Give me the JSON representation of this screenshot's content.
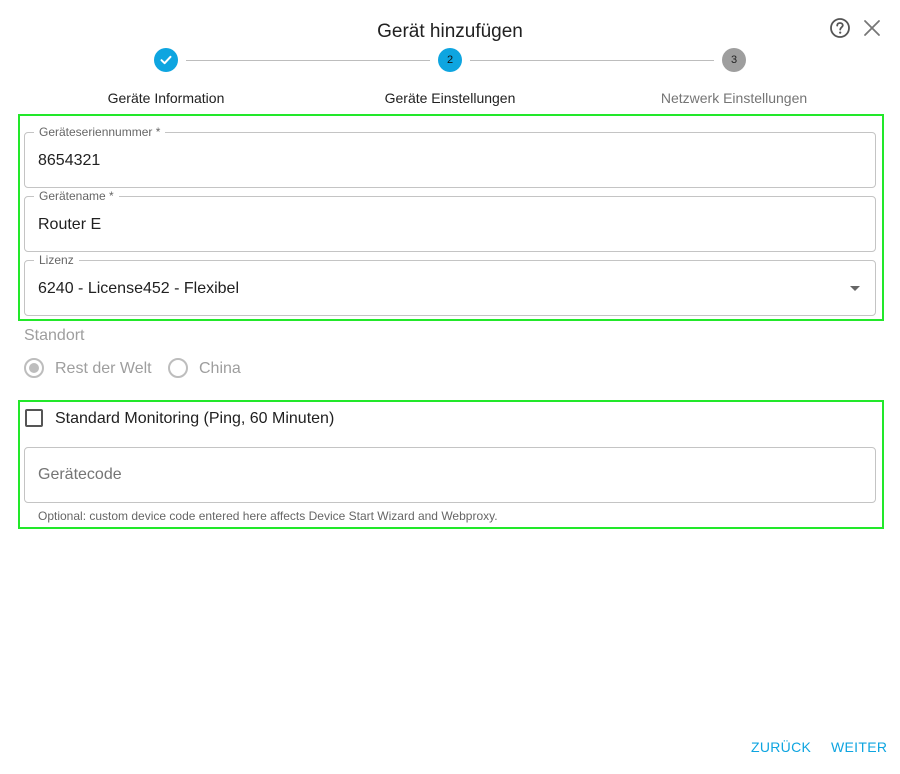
{
  "dialog": {
    "title": "Gerät hinzufügen",
    "help_icon": "help-circle-icon",
    "close_icon": "close-icon"
  },
  "stepper": {
    "steps": [
      {
        "number": "1",
        "label": "Geräte Information",
        "state": "completed",
        "icon": "check-icon"
      },
      {
        "number": "2",
        "label": "Geräte Einstellungen",
        "state": "active"
      },
      {
        "number": "3",
        "label": "Netzwerk Einstellungen",
        "state": "inactive"
      }
    ],
    "accent_color": "#0ea5e0",
    "inactive_color": "#9e9e9e"
  },
  "form": {
    "serial": {
      "label": "Geräteseriennummer *",
      "value": "8654321"
    },
    "name": {
      "label": "Gerätename *",
      "value": "Router E"
    },
    "license": {
      "label": "Lizenz",
      "value": "6240 - License452 - Flexibel"
    },
    "location": {
      "label": "Standort",
      "options": [
        {
          "label": "Rest der Welt",
          "selected": true
        },
        {
          "label": "China",
          "selected": false
        }
      ],
      "disabled": true
    },
    "monitoring": {
      "label": "Standard Monitoring (Ping, 60 Minuten)",
      "checked": false
    },
    "device_code": {
      "placeholder": "Gerätecode",
      "value": "",
      "helper": "Optional: custom device code entered here affects Device Start Wizard and Webproxy."
    }
  },
  "highlight_color": "#22e82a",
  "footer": {
    "back_label": "ZURÜCK",
    "next_label": "WEITER"
  }
}
